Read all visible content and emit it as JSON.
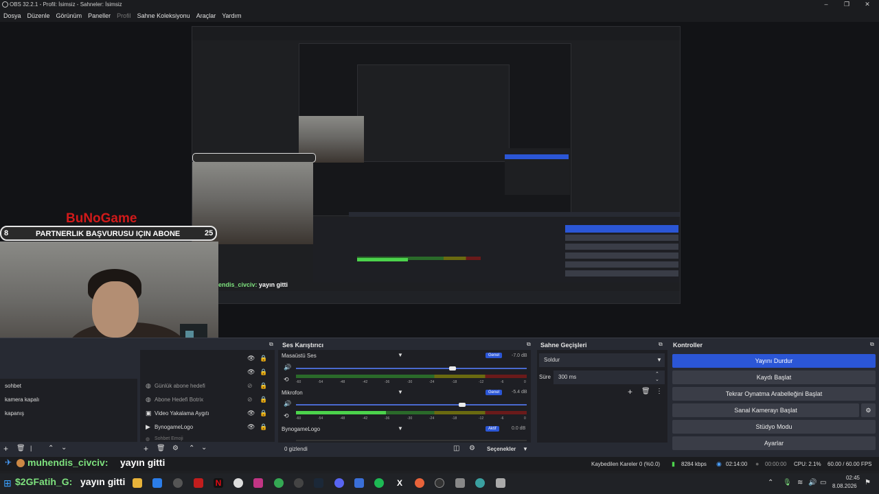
{
  "window": {
    "title": "OBS 32.2.1 - Profil: İsimsiz - Sahneler: İsimsiz"
  },
  "menu": {
    "items": [
      "Dosya",
      "Düzenle",
      "Görünüm",
      "Paneller",
      "Profil",
      "Sahne Koleksiyonu",
      "Araçlar",
      "Yardım"
    ]
  },
  "overlay": {
    "brand": "BuNoGame",
    "left_num": "8",
    "banner": "PARTNERLIK BAŞVURUSU IÇIN ABONE",
    "right_num": "25"
  },
  "chat": {
    "line1_user": "muhendis_civciv:",
    "line1_text": "yayın gitti",
    "line2_user": "$2GFatih_G:",
    "line2_text": "yayın gitti"
  },
  "scenes": {
    "items": [
      "sohbet",
      "kamera kapalı",
      "kapanış"
    ]
  },
  "sources": {
    "items": [
      {
        "label": "Günlük abone hedefi",
        "icon": "globe-icon"
      },
      {
        "label": "Abone Hedefi Botrix",
        "icon": "globe-icon"
      },
      {
        "label": "Video Yakalama Aygıtı",
        "icon": "camera-icon"
      },
      {
        "label": "BynogameLogo",
        "icon": "play-icon"
      },
      {
        "label": "Sohbet Emoji",
        "icon": "globe-icon"
      }
    ]
  },
  "mixer": {
    "title": "Ses Karıştırıcı",
    "ticks": [
      "-60",
      "-54",
      "-48",
      "-42",
      "-36",
      "-30",
      "-24",
      "-18",
      "-12",
      "-6",
      "0"
    ],
    "channels": [
      {
        "name": "Masaüstü Ses",
        "badge": "Genel",
        "db": "-7.0 dB",
        "level": 0.68,
        "meter": 0.0
      },
      {
        "name": "Mikrofon",
        "badge": "Genel",
        "db": "-5.4 dB",
        "level": 0.72,
        "meter": 0.39
      },
      {
        "name": "BynogameLogo",
        "badge": "Aktif",
        "db": "0.0 dB",
        "level": 1.0,
        "meter": 0.0
      }
    ],
    "hidden_label": "0 gizlendi",
    "selections_label": "Seçenekler"
  },
  "transitions": {
    "title": "Sahne Geçişleri",
    "selected": "Soldur",
    "duration_label": "Süre",
    "duration_value": "300 ms"
  },
  "controls": {
    "title": "Kontroller",
    "buttons": [
      "Yayını Durdur",
      "Kaydı Başlat",
      "Tekrar Oynatma Arabelleğini Başlat",
      "Sanal Kamerayı Başlat",
      "Stüdyo Modu",
      "Ayarlar"
    ]
  },
  "status": {
    "dropped": "Kaybedilen Kareler 0 (%0.0)",
    "bitrate": "8284 kbps",
    "stream_time": "02:14:00",
    "rec_time": "00:00:00",
    "cpu": "CPU: 2.1%",
    "fps": "60.00 / 60.00 FPS"
  },
  "taskbar": {
    "time": "02:45",
    "date": "8.08.2026"
  },
  "colors": {
    "accent": "#2b56d6",
    "meter_green": "#4cd34c",
    "dock": "#272a33"
  }
}
